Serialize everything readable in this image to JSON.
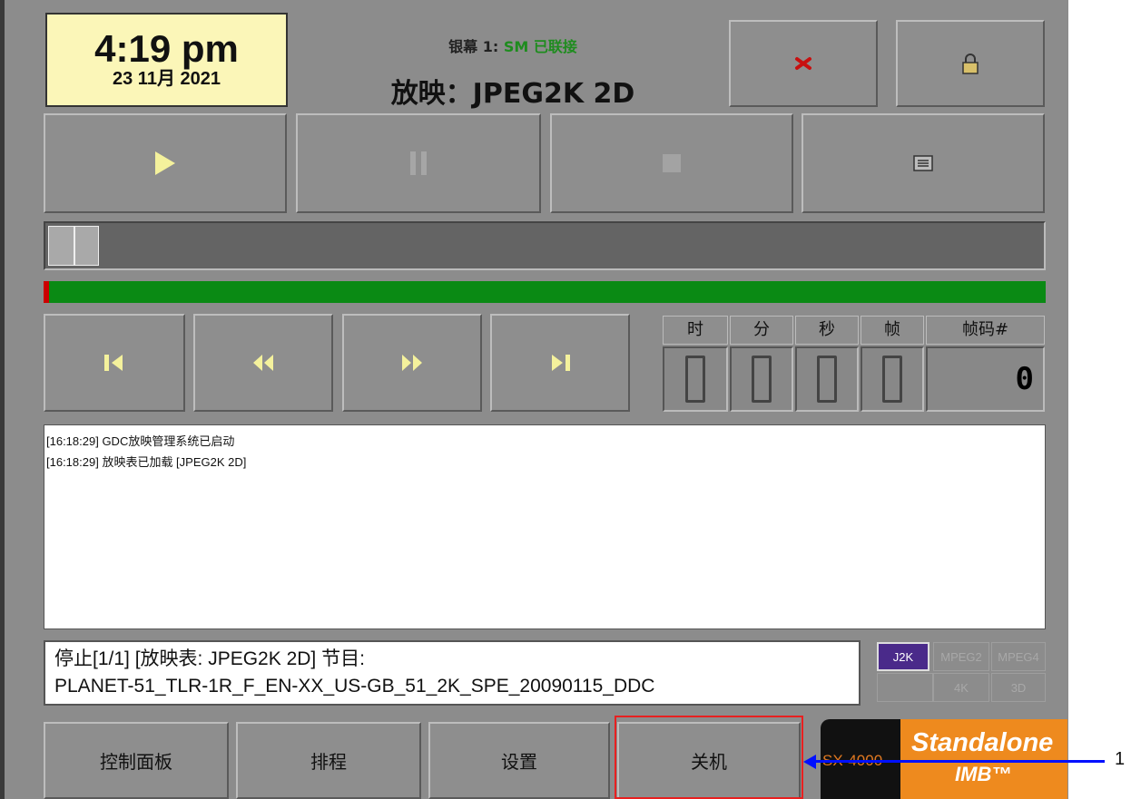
{
  "clock": {
    "time": "4:19 pm",
    "date": "23 11月 2021"
  },
  "screen": {
    "label": "银幕 1:",
    "status": "SM 已联接",
    "playing": "放映：JPEG2K 2D"
  },
  "timecode": {
    "headers": [
      "时",
      "分",
      "秒",
      "帧",
      "帧码#"
    ],
    "values": [
      "0",
      "0",
      "0",
      "0"
    ],
    "frame": "0"
  },
  "playback": {
    "position_fraction": 0.0
  },
  "log": {
    "lines": [
      "[16:18:29] GDC放映管理系统已启动",
      "[16:18:29] 放映表已加载 [JPEG2K 2D]"
    ]
  },
  "status_bar": {
    "line1": "停止[1/1] [放映表: JPEG2K 2D] 节目:",
    "line2": "PLANET-51_TLR-1R_F_EN-XX_US-GB_51_2K_SPE_20090115_DDC"
  },
  "formats": {
    "active": "J2K",
    "items": [
      "J2K",
      "MPEG2",
      "MPEG4",
      "4K",
      "3D"
    ]
  },
  "bottom_buttons": [
    "控制面板",
    "排程",
    "设置",
    "关机"
  ],
  "logo": {
    "model": "SX-4000",
    "line1": "Standalone",
    "line2": "IMB™"
  },
  "callout": {
    "number": "1"
  },
  "colors": {
    "background": "#8c8c8c",
    "clock_bg": "#fbf6b8",
    "progress_green": "#0a8a14",
    "highlight": "#e82020",
    "arrow": "#0010ff",
    "logo_orange": "#ee8a1e"
  },
  "icons": [
    "close-icon",
    "lock-icon",
    "play-icon",
    "pause-icon",
    "stop-icon",
    "playlist-icon",
    "skip-start-icon",
    "rewind-icon",
    "fast-forward-icon",
    "skip-end-icon"
  ]
}
